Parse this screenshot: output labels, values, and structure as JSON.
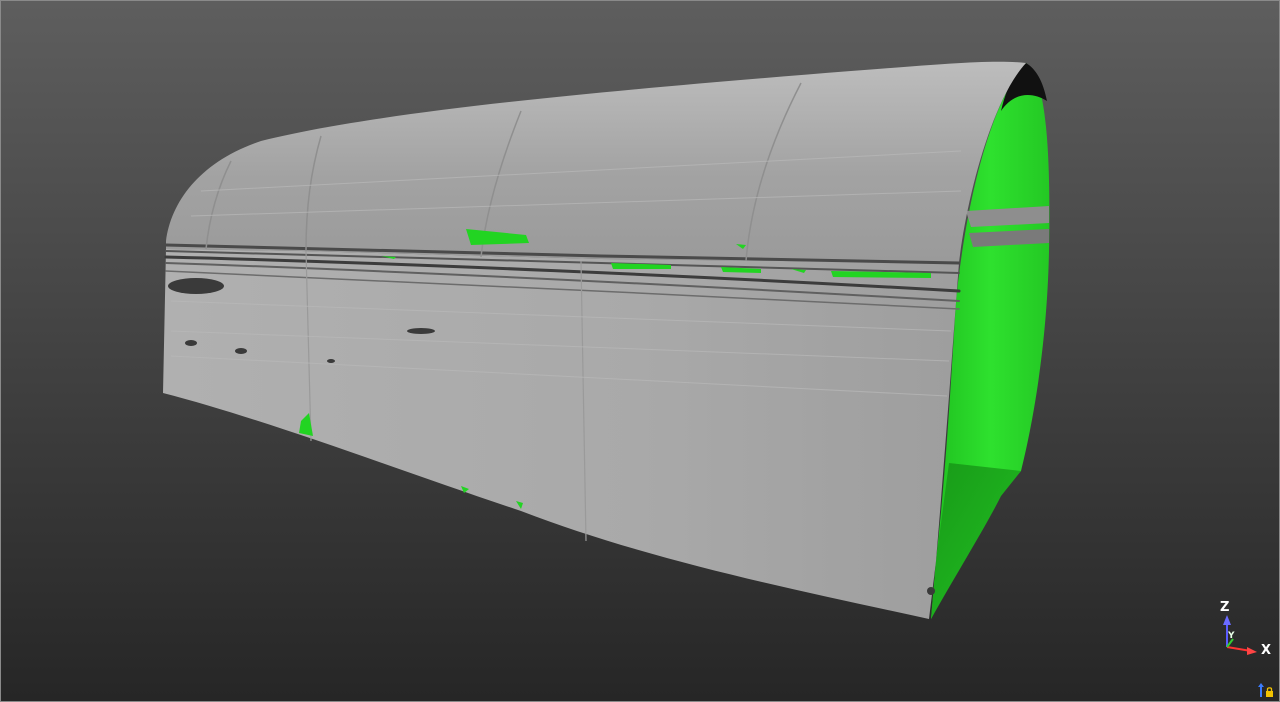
{
  "viewer": {
    "background_top": "#5d5d5d",
    "background_bottom": "#2a2a2a",
    "mesh_color": "#a6a6a6",
    "highlight_color": "#25d825"
  },
  "axes": {
    "z_label": "Z",
    "y_label": "Y",
    "x_label": "X",
    "z_color": "#5b5bff",
    "y_color": "#33cc33",
    "x_color": "#ff3333"
  },
  "icons": {
    "tunnel_model": "tunnel-mesh",
    "orientation": "axis-triad",
    "lock": "lock-icon"
  }
}
